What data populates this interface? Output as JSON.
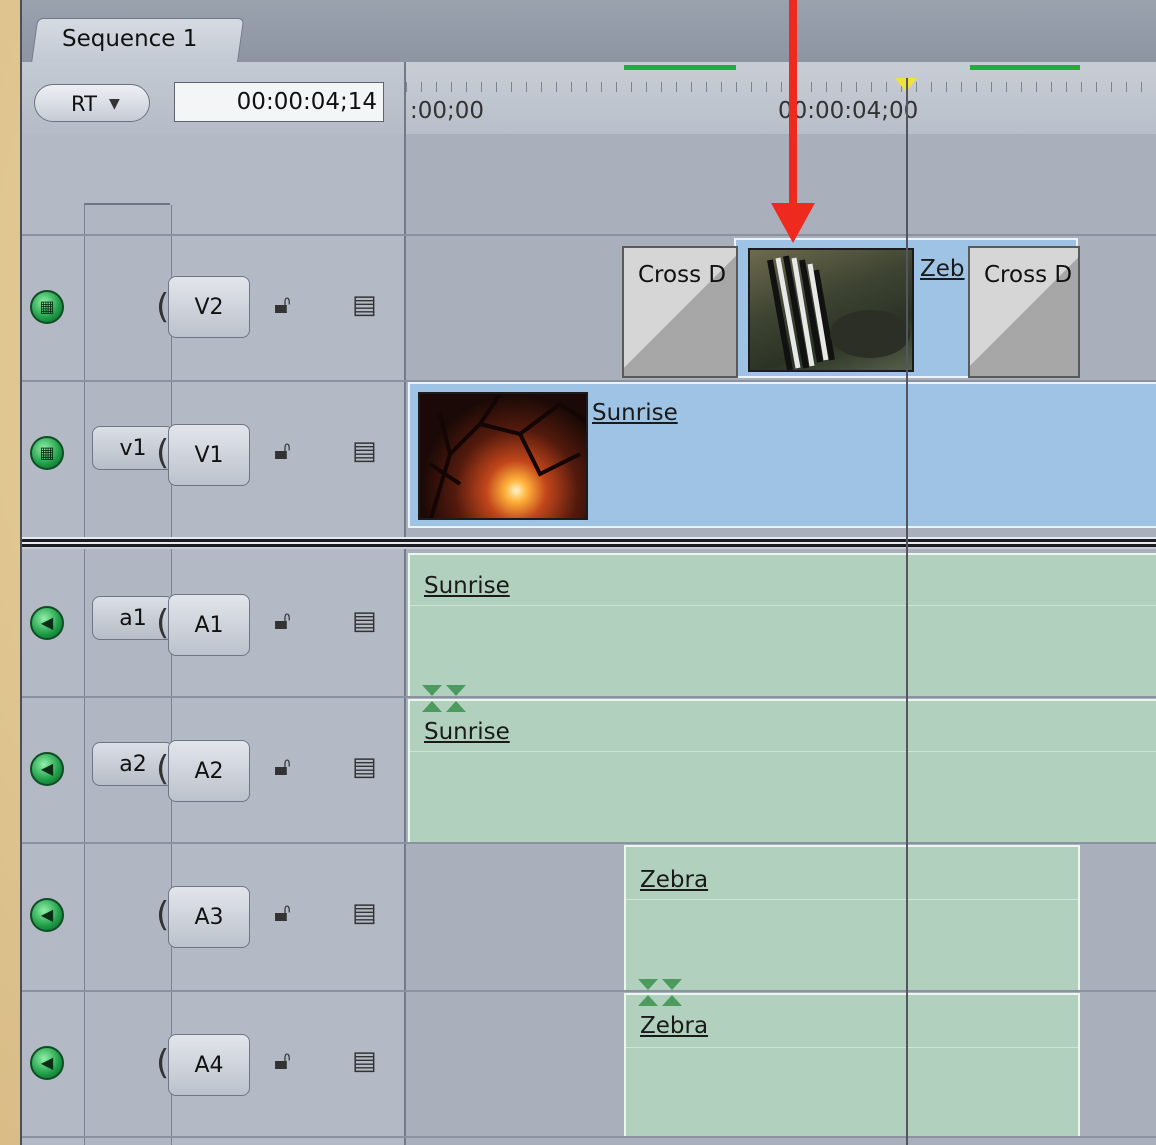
{
  "sequence_tab": {
    "label": "Sequence 1"
  },
  "header": {
    "rt_label": "RT",
    "timecode": "00:00:04;14"
  },
  "ruler": {
    "start_label": ":00;00",
    "mid_label": "00:00:04;00"
  },
  "tracks": {
    "v2": {
      "dest": "V2"
    },
    "v1": {
      "src": "v1",
      "dest": "V1"
    },
    "a1": {
      "src": "a1",
      "dest": "A1"
    },
    "a2": {
      "src": "a2",
      "dest": "A2"
    },
    "a3": {
      "dest": "A3"
    },
    "a4": {
      "dest": "A4"
    }
  },
  "clips": {
    "v2_transition_left": "Cross D",
    "v2_clip": "Zeb",
    "v2_transition_right": "Cross D",
    "v1_clip": "Sunrise",
    "a1_clip": "Sunrise",
    "a2_clip": "Sunrise",
    "a3_clip": "Zebra",
    "a4_clip": "Zebra"
  },
  "colors": {
    "video_clip": "#9fc3e4",
    "audio_clip": "#b1d1be",
    "render_bar": "#1fae3c",
    "annotation_arrow": "#ee2a1f",
    "playhead_marker": "#f0e23a"
  }
}
